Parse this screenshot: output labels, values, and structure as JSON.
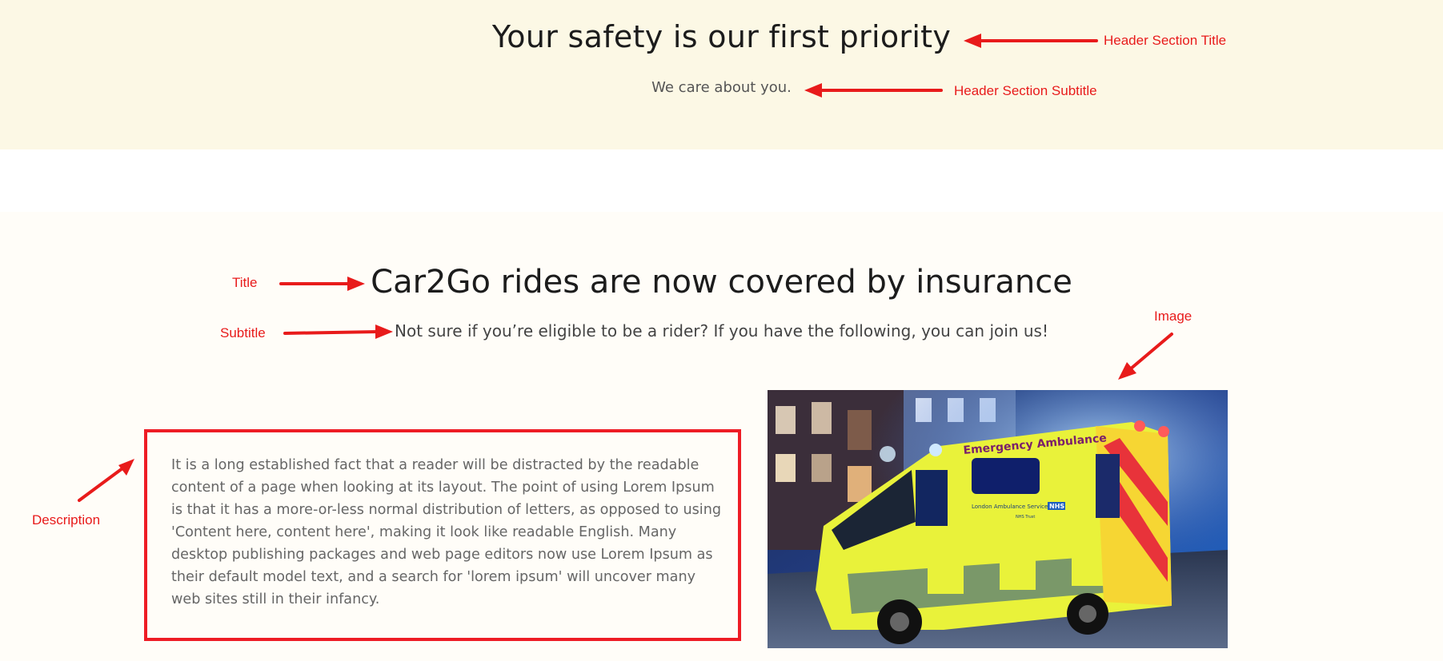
{
  "header": {
    "title": "Your safety is our first priority",
    "subtitle": "We care about you."
  },
  "main": {
    "title": "Car2Go rides are now covered by insurance",
    "subtitle": "Not sure if you’re eligible to be a rider? If you have the following, you can join us!",
    "description": "It is a long established fact that a reader will be distracted by the readable content of a page when looking at its layout. The point of using Lorem Ipsum is that it has a more-or-less normal distribution of letters, as opposed to using 'Content here, content here', making it look like readable English. Many desktop publishing packages and web page editors now use Lorem Ipsum as their default model text, and a search for 'lorem ipsum' will uncover many web sites still in their infancy.",
    "image_vehicle_text": {
      "heading": "Emergency Ambulance",
      "service": "London Ambulance Service",
      "badge": "NHS",
      "trust": "NHS Trust"
    }
  },
  "annotations": {
    "header_title": "Header Section Title",
    "header_subtitle": "Header Section Subtitle",
    "title": "Title",
    "subtitle": "Subtitle",
    "image": "Image",
    "description": "Description"
  },
  "colors": {
    "header_band": "#fcf8e5",
    "annotation": "#e81b1b",
    "page_background": "#fffdf8"
  }
}
